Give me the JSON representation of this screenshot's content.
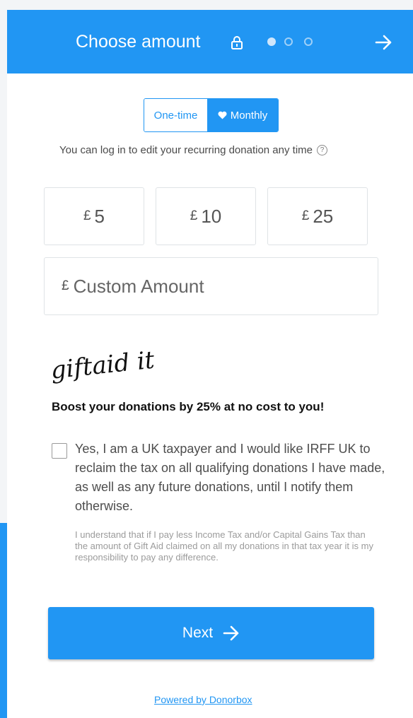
{
  "header": {
    "title": "Choose amount",
    "steps": {
      "current": 1,
      "total": 3
    }
  },
  "frequency": {
    "one_time_label": "One-time",
    "monthly_label": "Monthly",
    "selected": "Monthly"
  },
  "recurring_note": "You can log in to edit your recurring donation any time",
  "help_glyph": "?",
  "amounts": [
    {
      "currency": "£",
      "value": "5"
    },
    {
      "currency": "£",
      "value": "10"
    },
    {
      "currency": "£",
      "value": "25"
    }
  ],
  "custom_amount": {
    "currency": "£",
    "placeholder": "Custom Amount",
    "value": ""
  },
  "giftaid": {
    "logo_text": "giftaid it",
    "boost_text": "Boost your donations by 25% at no cost to you!",
    "consent_checked": false,
    "consent_text": "Yes, I am a UK taxpayer and I would like IRFF UK to reclaim the tax on all qualifying donations I have made, as well as any future donations, until I notify them otherwise.",
    "disclaimer": "I understand that if I pay less Income Tax and/or Capital Gains Tax than the amount of Gift Aid claimed on all my donations in that tax year it is my responsibility to pay any difference."
  },
  "next_label": "Next",
  "footer": {
    "powered_by": "Powered by Donorbox"
  },
  "colors": {
    "brand": "#2196f3",
    "text": "#4d4d4d"
  },
  "icons": {
    "header": [
      "lock-icon",
      "arrow-right-icon"
    ],
    "toggle": "heart-icon",
    "help": "question-circle-icon"
  }
}
